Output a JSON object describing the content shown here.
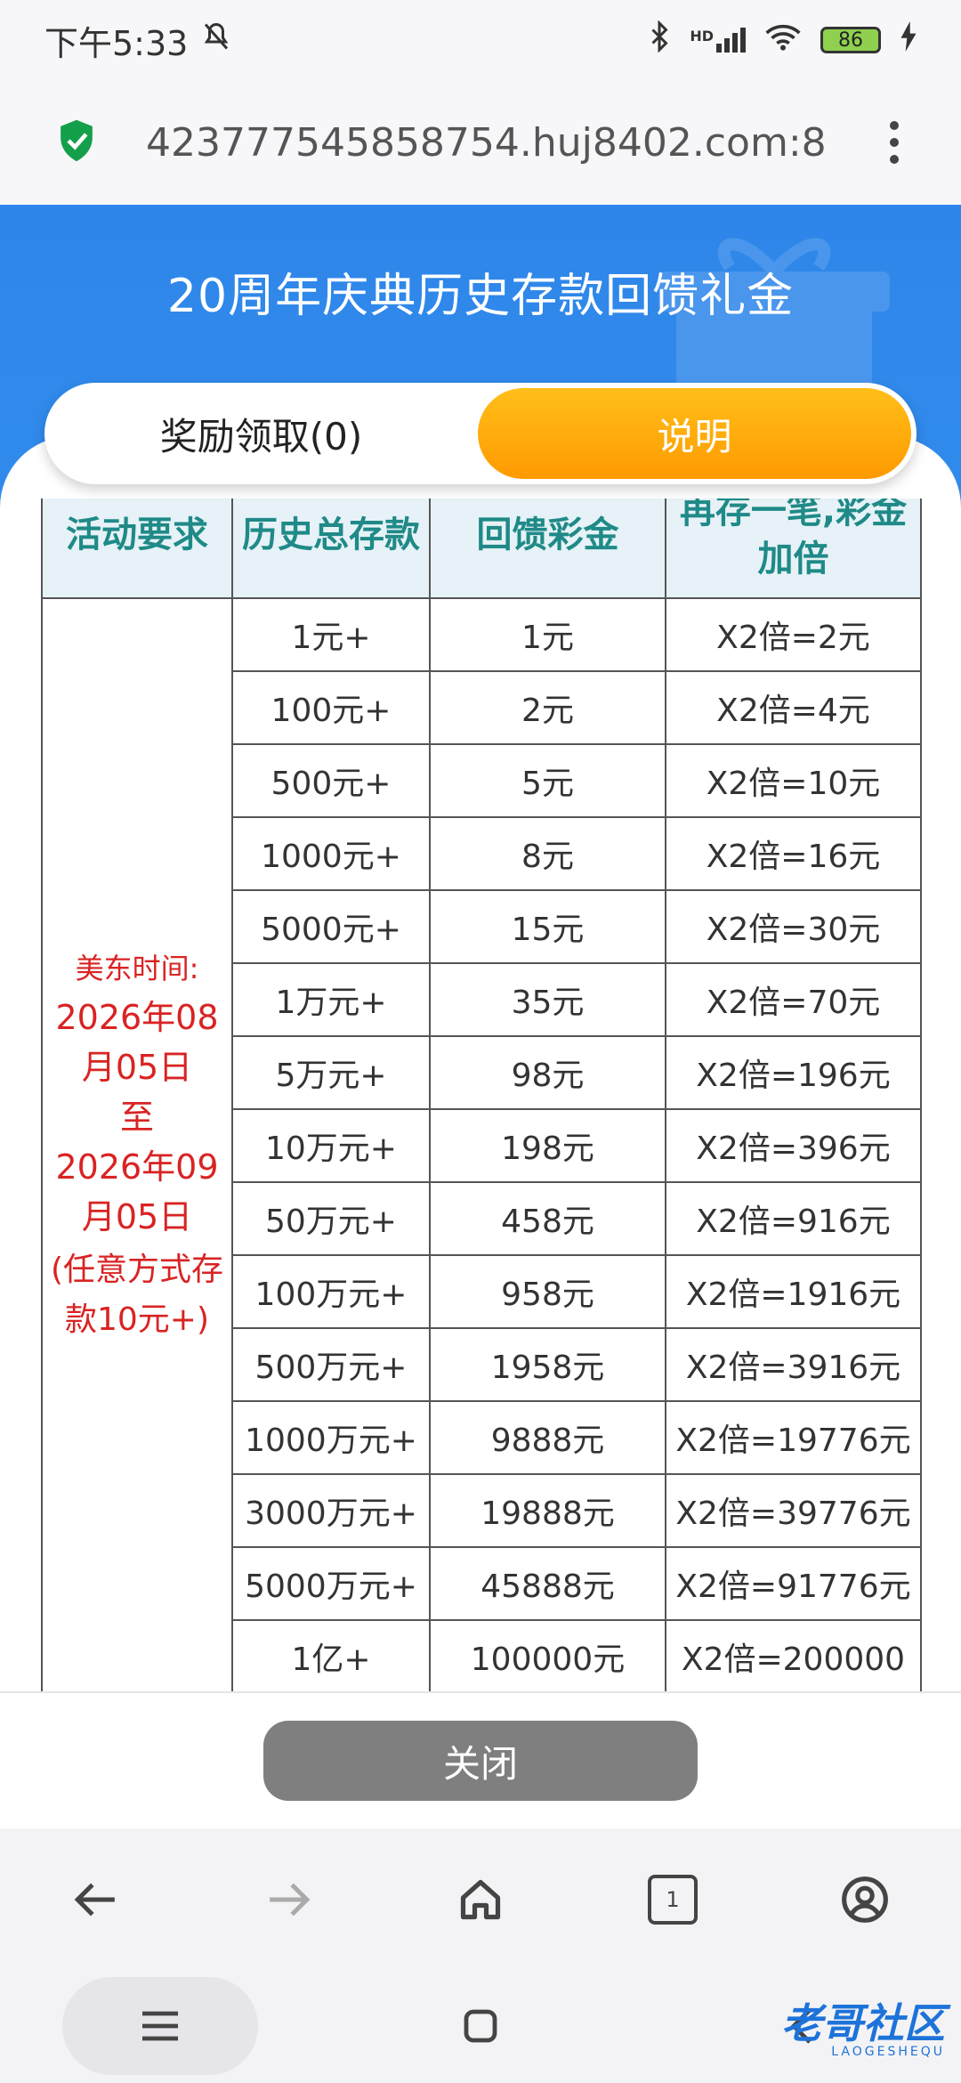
{
  "status_bar": {
    "time": "下午5:33",
    "network": "HD",
    "battery": "86"
  },
  "browser": {
    "url": "423777545858754.huj8402.com:8"
  },
  "page": {
    "title": "20周年庆典历史存款回馈礼金",
    "tabs": [
      {
        "label": "奖励领取(0)",
        "active": false
      },
      {
        "label": "说明",
        "active": true
      }
    ]
  },
  "table": {
    "headers": [
      "活动要求",
      "历史总存款",
      "回馈彩金",
      "再存一笔,彩金加倍"
    ],
    "requirement": {
      "line1": "美东时间:",
      "line2": "2026年08月05日",
      "line3": "至",
      "line4": "2026年09月05日",
      "line5": "(任意方式存款10元+)"
    },
    "rows": [
      {
        "deposit": "1元+",
        "bonus": "1元",
        "double": "X2倍=2元"
      },
      {
        "deposit": "100元+",
        "bonus": "2元",
        "double": "X2倍=4元"
      },
      {
        "deposit": "500元+",
        "bonus": "5元",
        "double": "X2倍=10元"
      },
      {
        "deposit": "1000元+",
        "bonus": "8元",
        "double": "X2倍=16元"
      },
      {
        "deposit": "5000元+",
        "bonus": "15元",
        "double": "X2倍=30元"
      },
      {
        "deposit": "1万元+",
        "bonus": "35元",
        "double": "X2倍=70元"
      },
      {
        "deposit": "5万元+",
        "bonus": "98元",
        "double": "X2倍=196元"
      },
      {
        "deposit": "10万元+",
        "bonus": "198元",
        "double": "X2倍=396元"
      },
      {
        "deposit": "50万元+",
        "bonus": "458元",
        "double": "X2倍=916元"
      },
      {
        "deposit": "100万元+",
        "bonus": "958元",
        "double": "X2倍=1916元"
      },
      {
        "deposit": "500万元+",
        "bonus": "1958元",
        "double": "X2倍=3916元"
      },
      {
        "deposit": "1000万元+",
        "bonus": "9888元",
        "double": "X2倍=19776元"
      },
      {
        "deposit": "3000万元+",
        "bonus": "19888元",
        "double": "X2倍=39776元"
      },
      {
        "deposit": "5000万元+",
        "bonus": "45888元",
        "double": "X2倍=91776元"
      },
      {
        "deposit": "1亿+",
        "bonus": "100000元",
        "double": "X2倍=200000"
      }
    ]
  },
  "close_button": "关闭",
  "browser_nav": {
    "tabs_count": "1"
  },
  "watermark": {
    "main": "老哥社区",
    "sub": "LAOGESHEQU"
  },
  "colors": {
    "banner": "#2f86ea",
    "active_tab": "#ff9a00",
    "header_text": "#1f8a87",
    "requirement_text": "#d92323",
    "close_button": "#7f7f7f"
  }
}
